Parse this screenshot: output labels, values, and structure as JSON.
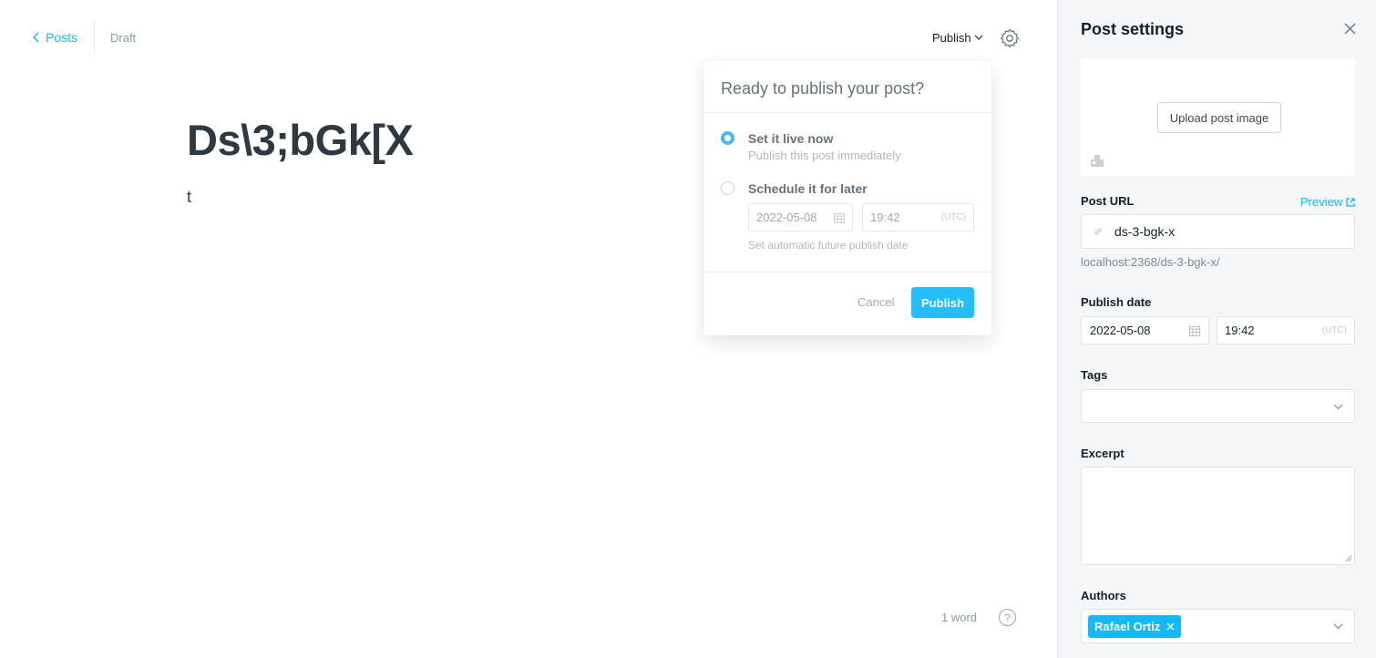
{
  "header": {
    "back_label": "Posts",
    "status": "Draft",
    "publish_menu_label": "Publish"
  },
  "post": {
    "title": "Ds\\3;bGk[X",
    "body": "t"
  },
  "footer": {
    "word_count": "1 word",
    "help_label": "?"
  },
  "publish_popover": {
    "title": "Ready to publish your post?",
    "option_now_label": "Set it live now",
    "option_now_sub": "Publish this post immediately",
    "option_later_label": "Schedule it for later",
    "option_later_sub": "Set automatic future publish date",
    "date": "2022-05-08",
    "time": "19:42",
    "timezone": "(UTC)",
    "selected": "now",
    "cancel_label": "Cancel",
    "publish_label": "Publish"
  },
  "sidebar": {
    "title": "Post settings",
    "upload_label": "Upload post image",
    "post_url_label": "Post URL",
    "preview_label": "Preview",
    "slug": "ds-3-bgk-x",
    "url_hint": "localhost:2368/ds-3-bgk-x/",
    "publish_date_label": "Publish date",
    "publish_date": "2022-05-08",
    "publish_time": "19:42",
    "timezone": "(UTC)",
    "tags_label": "Tags",
    "excerpt_label": "Excerpt",
    "authors_label": "Authors",
    "authors": [
      "Rafael Ortiz"
    ]
  },
  "colors": {
    "accent": "#14b8ff",
    "radio_checked": "#3eb0ef",
    "sidebar_bg": "#f4f6f8",
    "title_text": "#2e3942"
  },
  "icons": [
    "chevron-left-icon",
    "chevron-down-icon",
    "gear-icon",
    "help-icon",
    "calendar-icon",
    "close-icon",
    "image-icon",
    "link-icon",
    "external-link-icon"
  ]
}
